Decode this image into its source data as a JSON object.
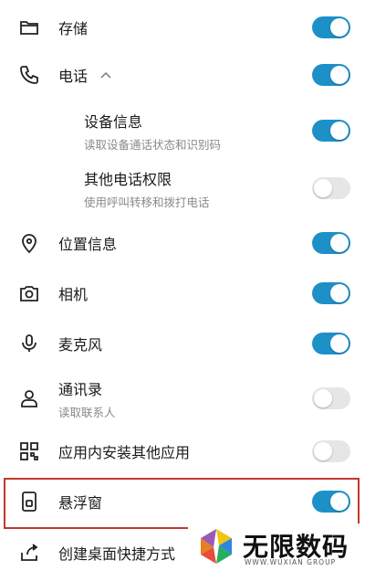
{
  "permissions": [
    {
      "label": "存储",
      "icon": "folder-icon",
      "state": "on"
    },
    {
      "label": "电话",
      "icon": "phone-icon",
      "state": "on",
      "expand_glyph": "^"
    },
    {
      "label": "设备信息",
      "sub": "读取设备通话状态和识别码",
      "state": "on"
    },
    {
      "label": "其他电话权限",
      "sub": "使用呼叫转移和拨打电话",
      "state": "off"
    },
    {
      "label": "位置信息",
      "icon": "location-pin-icon",
      "state": "on"
    },
    {
      "label": "相机",
      "icon": "camera-icon",
      "state": "on"
    },
    {
      "label": "麦克风",
      "icon": "microphone-icon",
      "state": "on"
    },
    {
      "label": "通讯录",
      "sub": "读取联系人",
      "icon": "contact-icon",
      "state": "off"
    },
    {
      "label": "应用内安装其他应用",
      "icon": "apps-grid-icon",
      "state": "off"
    },
    {
      "label": "悬浮窗",
      "icon": "floating-window-icon",
      "state": "on"
    },
    {
      "label": "创建桌面快捷方式",
      "icon": "share-shortcut-icon"
    }
  ],
  "colors": {
    "toggle_on": "#1e90c8",
    "toggle_off": "#e6e6e6",
    "highlight": "#c0392b"
  },
  "watermark": {
    "title": "无限数码",
    "subtitle": "WWW.WUXIAN GROUP"
  }
}
